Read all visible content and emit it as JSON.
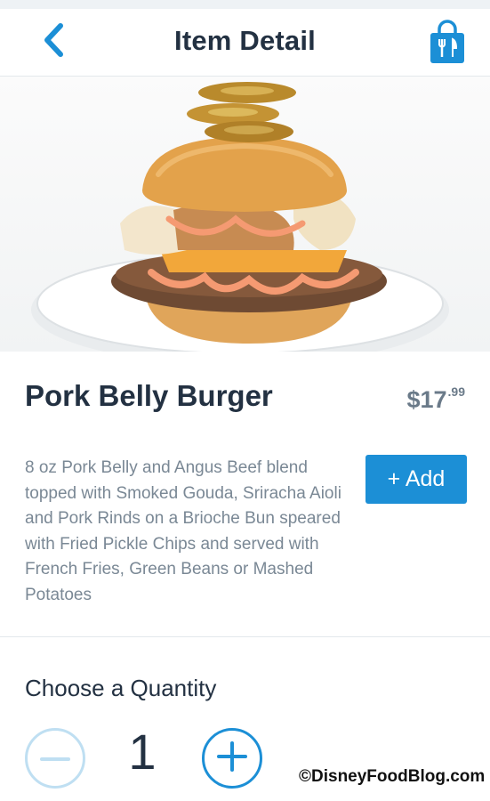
{
  "header": {
    "title": "Item Detail",
    "back_icon": "chevron-left-icon",
    "bag_icon": "shopping-bag-utensils-icon"
  },
  "item": {
    "name": "Pork Belly Burger",
    "price_dollars": "$17",
    "price_cents": ".99",
    "description": "8 oz Pork Belly and Angus Beef blend topped with Smoked Gouda, Sriracha Aioli and Pork Rinds on a Brioche Bun speared with Fried Pickle Chips and served with French Fries, Green Beans or Mashed Potatoes",
    "add_label": "+ Add"
  },
  "quantity": {
    "label": "Choose a Quantity",
    "value": "1"
  },
  "watermark": "©DisneyFoodBlog.com",
  "colors": {
    "accent": "#1c8fd6",
    "title_text": "#233142",
    "muted_text": "#7a8895",
    "price_text": "#6a7a89"
  }
}
